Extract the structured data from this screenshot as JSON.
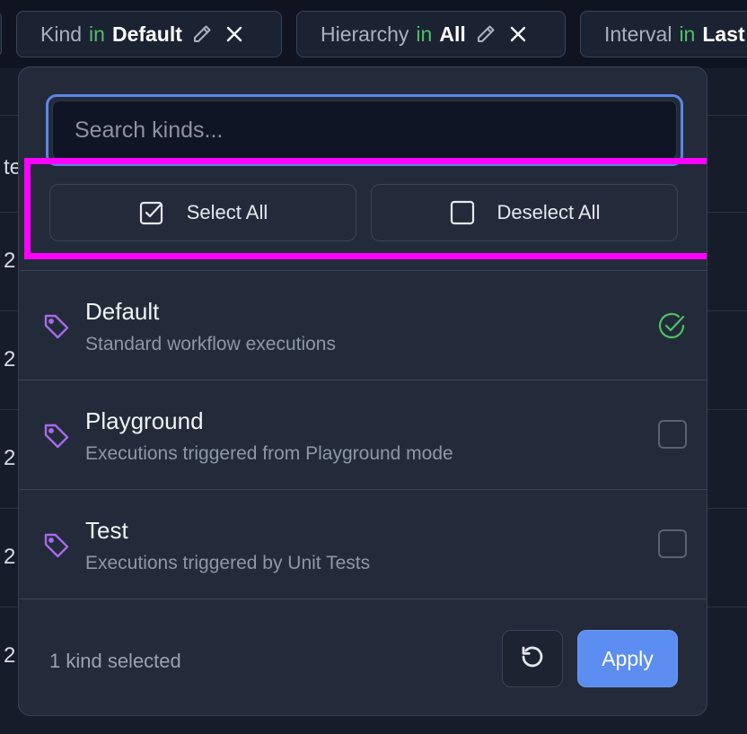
{
  "filters": [
    {
      "field": "Kind",
      "op": "in",
      "value": "Default"
    },
    {
      "field": "Hierarchy",
      "op": "in",
      "value": "All"
    },
    {
      "field": "Interval",
      "op": "in",
      "value": "Last"
    }
  ],
  "background": {
    "header_fragment": "te",
    "row_prefix": "2"
  },
  "dropdown": {
    "search_placeholder": "Search kinds...",
    "select_all_label": "Select All",
    "deselect_all_label": "Deselect All",
    "items": [
      {
        "name": "Default",
        "description": "Standard workflow executions",
        "selected": true
      },
      {
        "name": "Playground",
        "description": "Executions triggered from Playground mode",
        "selected": false
      },
      {
        "name": "Test",
        "description": "Executions triggered by Unit Tests",
        "selected": false
      }
    ],
    "selected_count_text": "1 kind selected",
    "apply_label": "Apply"
  },
  "colors": {
    "accent": "#5b8ef0",
    "operator_green": "#4fbf67",
    "tag_purple": "#a86be8",
    "highlight": "#ff00ff"
  }
}
